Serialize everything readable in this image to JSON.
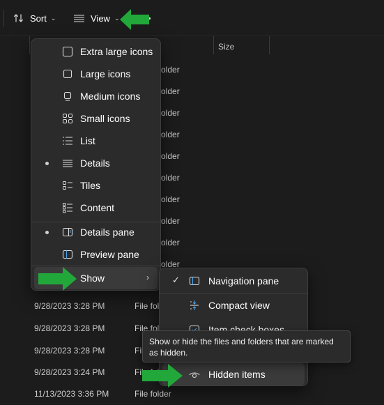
{
  "toolbar": {
    "sort_label": "Sort",
    "view_label": "View"
  },
  "columns": {
    "size": "Size"
  },
  "list": {
    "type_partial": "older",
    "rows": [
      {
        "date": "9/28/2023 3:28 PM",
        "type": "File folder"
      },
      {
        "date": "9/28/2023 3:28 PM",
        "type": "File folder"
      },
      {
        "date": "9/28/2023 3:28 PM",
        "type": "File folder"
      },
      {
        "date": "9/28/2023 3:24 PM",
        "type": "File folder"
      },
      {
        "date": "11/13/2023 3:36 PM",
        "type": "File folder"
      }
    ]
  },
  "view_menu": {
    "items": [
      {
        "label": "Extra large icons",
        "icon": "extra-large-icons-icon"
      },
      {
        "label": "Large icons",
        "icon": "large-icons-icon"
      },
      {
        "label": "Medium icons",
        "icon": "medium-icons-icon"
      },
      {
        "label": "Small icons",
        "icon": "small-icons-icon"
      },
      {
        "label": "List",
        "icon": "list-icon"
      },
      {
        "label": "Details",
        "icon": "details-icon",
        "selected": true
      },
      {
        "label": "Tiles",
        "icon": "tiles-icon"
      },
      {
        "label": "Content",
        "icon": "content-icon"
      }
    ],
    "panes": [
      {
        "label": "Details pane",
        "icon": "details-pane-icon",
        "selected": true
      },
      {
        "label": "Preview pane",
        "icon": "preview-pane-icon"
      }
    ],
    "show": {
      "label": "Show",
      "icon": "chevron-right-icon"
    }
  },
  "show_submenu": {
    "items": [
      {
        "label": "Navigation pane",
        "icon": "navigation-pane-icon",
        "checked": true
      },
      {
        "label": "Compact view",
        "icon": "compact-view-icon"
      },
      {
        "label": "Item check boxes",
        "icon": "item-check-boxes-icon"
      },
      {
        "label": "Hidden items",
        "icon": "hidden-items-icon"
      }
    ]
  },
  "tooltip": {
    "text": "Show or hide the files and folders that are marked as hidden."
  },
  "colors": {
    "annotation_arrow": "#22a83a",
    "menu_bg": "#2b2b2b",
    "window_bg": "#1c1c1c"
  }
}
